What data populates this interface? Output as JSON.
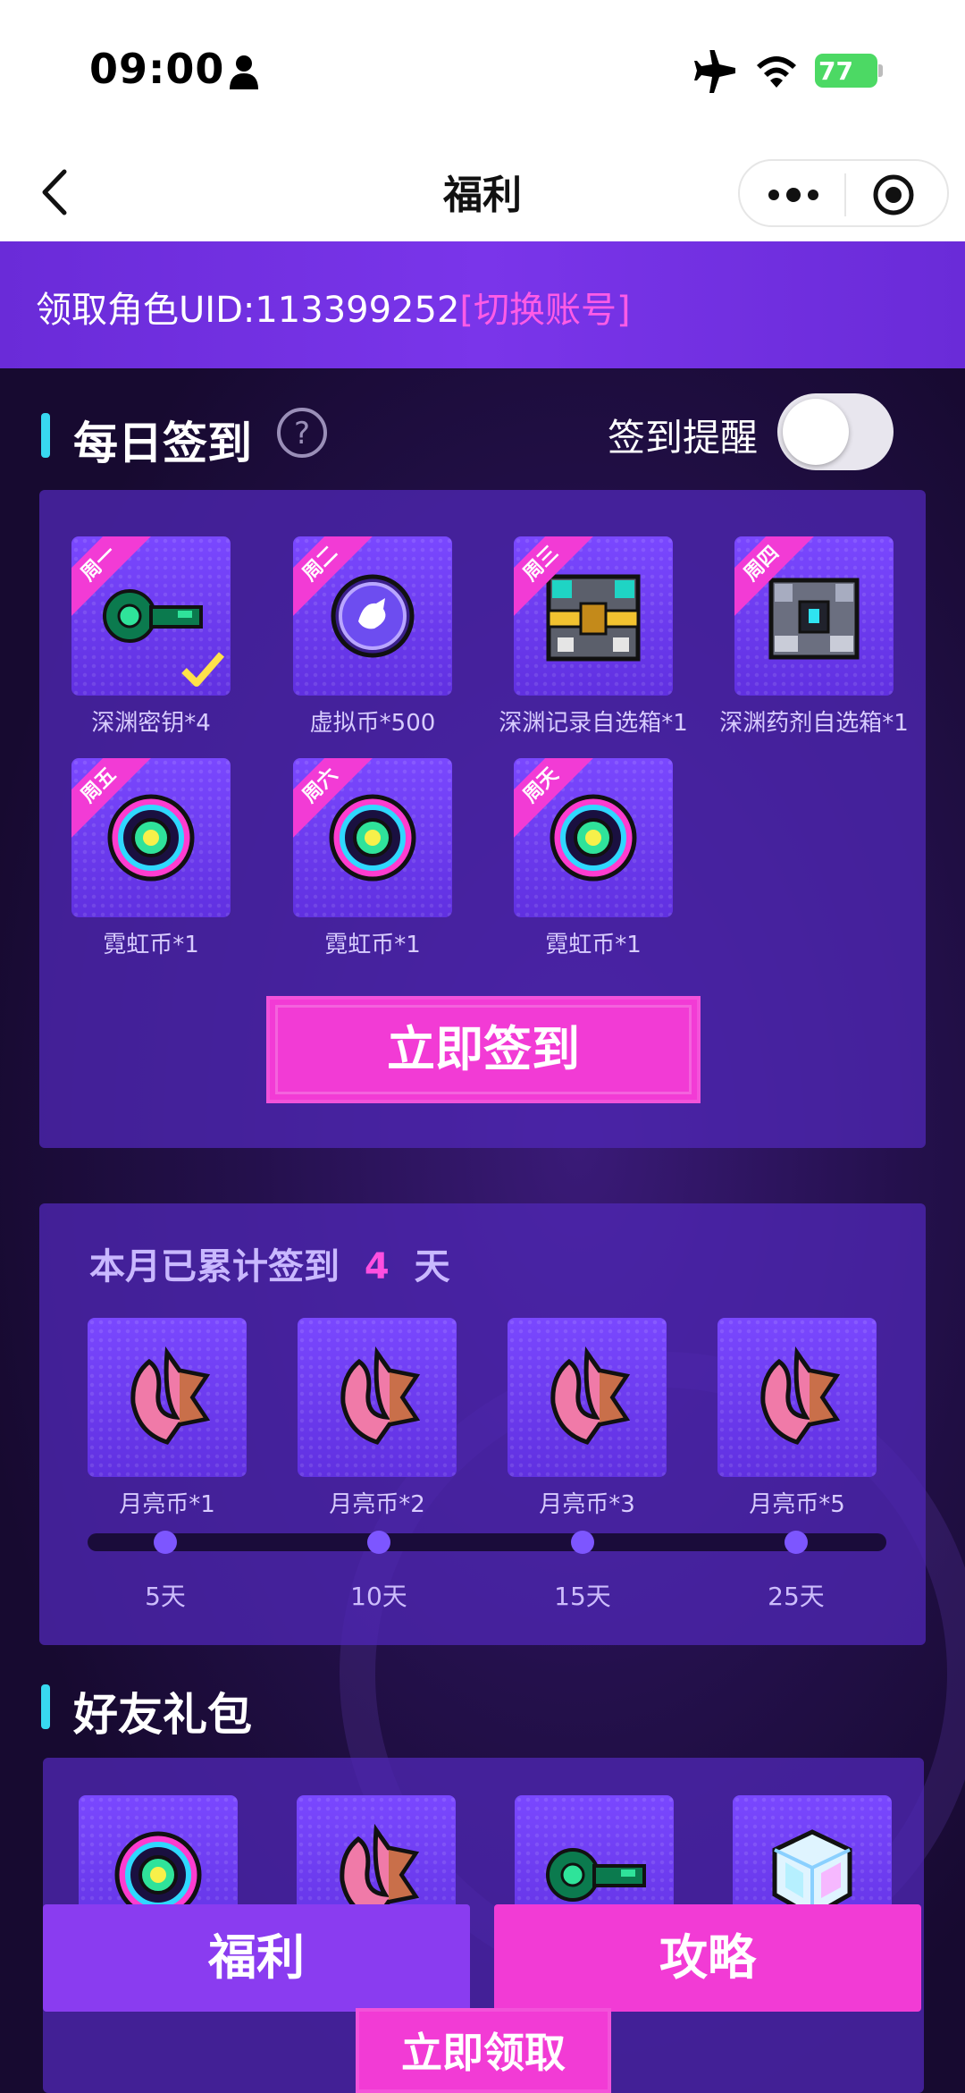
{
  "status_bar": {
    "time": "09:00",
    "battery": "77"
  },
  "navbar": {
    "title": "福利"
  },
  "account": {
    "prefix": "领取角色UID:113399252",
    "switch_label": "[切换账号]"
  },
  "daily_signin": {
    "title": "每日签到",
    "reminder_label": "签到提醒",
    "reminder_on": false,
    "items": [
      {
        "day": "周一",
        "label": "深渊密钥*4",
        "icon": "green-key-icon",
        "claimed": true
      },
      {
        "day": "周二",
        "label": "虚拟币*500",
        "icon": "purple-coin-icon",
        "claimed": false
      },
      {
        "day": "周三",
        "label": "深渊记录自选箱*1",
        "icon": "record-chest-icon",
        "claimed": false
      },
      {
        "day": "周四",
        "label": "深渊药剂自选箱*1",
        "icon": "potion-chest-icon",
        "claimed": false
      },
      {
        "day": "周五",
        "label": "霓虹币*1",
        "icon": "neon-coin-icon",
        "claimed": false
      },
      {
        "day": "周六",
        "label": "霓虹币*1",
        "icon": "neon-coin-icon",
        "claimed": false
      },
      {
        "day": "周天",
        "label": "霓虹币*1",
        "icon": "neon-coin-icon",
        "claimed": false
      }
    ],
    "button_label": "立即签到"
  },
  "monthly": {
    "title_prefix": "本月已累计签到",
    "count": "4",
    "title_suffix": "天",
    "rewards": [
      {
        "label": "月亮币*1",
        "days": "5天",
        "icon": "moon-coin-icon"
      },
      {
        "label": "月亮币*2",
        "days": "10天",
        "icon": "moon-coin-icon"
      },
      {
        "label": "月亮币*3",
        "days": "15天",
        "icon": "moon-coin-icon"
      },
      {
        "label": "月亮币*5",
        "days": "25天",
        "icon": "moon-coin-icon"
      }
    ]
  },
  "friend_gift": {
    "title": "好友礼包",
    "items": [
      {
        "icon": "neon-coin-icon"
      },
      {
        "icon": "moon-coin-icon"
      },
      {
        "icon": "green-key-icon"
      },
      {
        "icon": "crystal-cube-icon"
      }
    ],
    "claim_label": "立即领取"
  },
  "bottom_tabs": {
    "welfare": "福利",
    "guide": "攻略"
  },
  "colors": {
    "accent_pink": "#f23bd5",
    "panel_purple": "#4e26b2",
    "cyan_bar": "#38d8f0"
  }
}
